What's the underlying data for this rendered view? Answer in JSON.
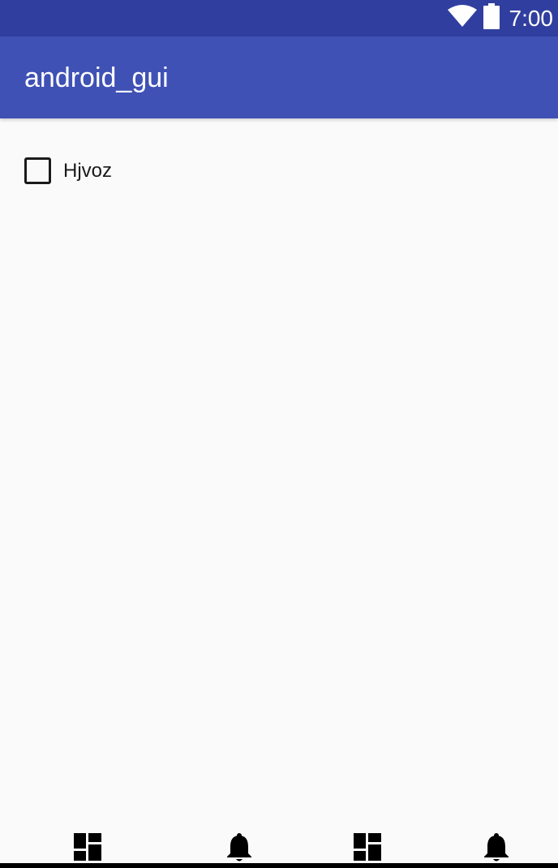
{
  "status_bar": {
    "time": "7:00",
    "icons": [
      "wifi-icon",
      "battery-icon"
    ],
    "background": "#303f9f"
  },
  "app_bar": {
    "title": "android_gui",
    "background": "#3f51b5"
  },
  "content": {
    "checkbox": {
      "label": "Hjvoz",
      "checked": false
    }
  },
  "bottom_nav": {
    "items": [
      {
        "icon": "dashboard-icon"
      },
      {
        "icon": "bell-icon"
      },
      {
        "icon": "dashboard-icon"
      },
      {
        "icon": "bell-icon"
      }
    ]
  },
  "colors": {
    "accent": "#3f51b5",
    "primary_dark": "#303f9f",
    "background": "#fafafa",
    "text": "#1a1a1a"
  }
}
